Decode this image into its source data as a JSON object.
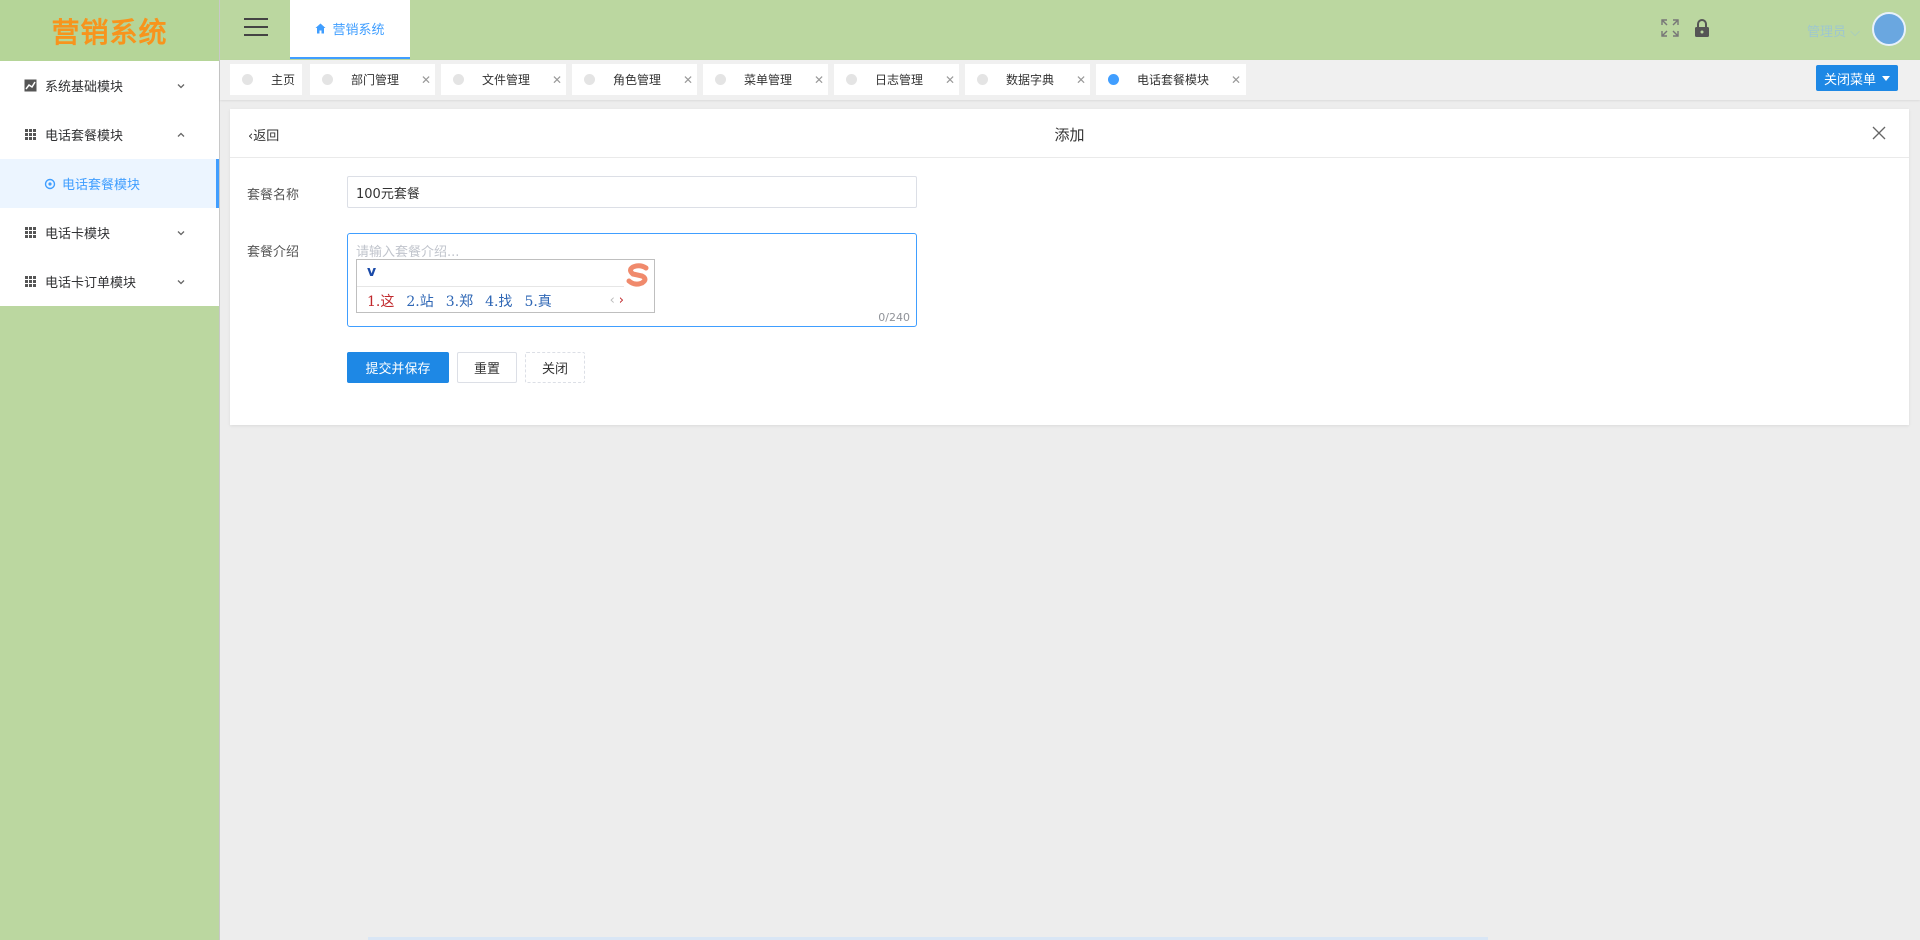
{
  "logo": "营销系统",
  "sidebar": {
    "items": [
      {
        "label": "系统基础模块",
        "icon": "chart-icon",
        "expanded": false
      },
      {
        "label": "电话套餐模块",
        "icon": "grid-icon",
        "expanded": true
      },
      {
        "label": "电话套餐模块",
        "icon": "gear-icon",
        "sub": true,
        "active": true
      },
      {
        "label": "电话卡模块",
        "icon": "grid-icon",
        "expanded": false
      },
      {
        "label": "电话卡订单模块",
        "icon": "grid-icon",
        "expanded": false
      }
    ]
  },
  "header": {
    "top_tab": "营销系统",
    "user": "管理员"
  },
  "tabs": [
    {
      "label": "主页",
      "closable": false
    },
    {
      "label": "部门管理",
      "closable": true
    },
    {
      "label": "文件管理",
      "closable": true
    },
    {
      "label": "角色管理",
      "closable": true
    },
    {
      "label": "菜单管理",
      "closable": true
    },
    {
      "label": "日志管理",
      "closable": true
    },
    {
      "label": "数据字典",
      "closable": true
    },
    {
      "label": "电话套餐模块",
      "closable": true,
      "active": true
    }
  ],
  "tabs_close_menu": "关闭菜单",
  "card": {
    "back": "返回",
    "title": "添加"
  },
  "form": {
    "name_label": "套餐名称",
    "name_value": "100元套餐",
    "intro_label": "套餐介绍",
    "intro_placeholder": "请输入套餐介绍...",
    "intro_counter": "0/240"
  },
  "ime": {
    "composition": "v",
    "candidates": [
      "1.这",
      "2.站",
      "3.郑",
      "4.找",
      "5.真"
    ]
  },
  "buttons": {
    "submit": "提交并保存",
    "reset": "重置",
    "close": "关闭"
  },
  "colors": {
    "accent": "#409eff",
    "sidebar_bg": "#bbd7a0",
    "logo": "#f7941d",
    "primary_button": "#1e88e5"
  }
}
